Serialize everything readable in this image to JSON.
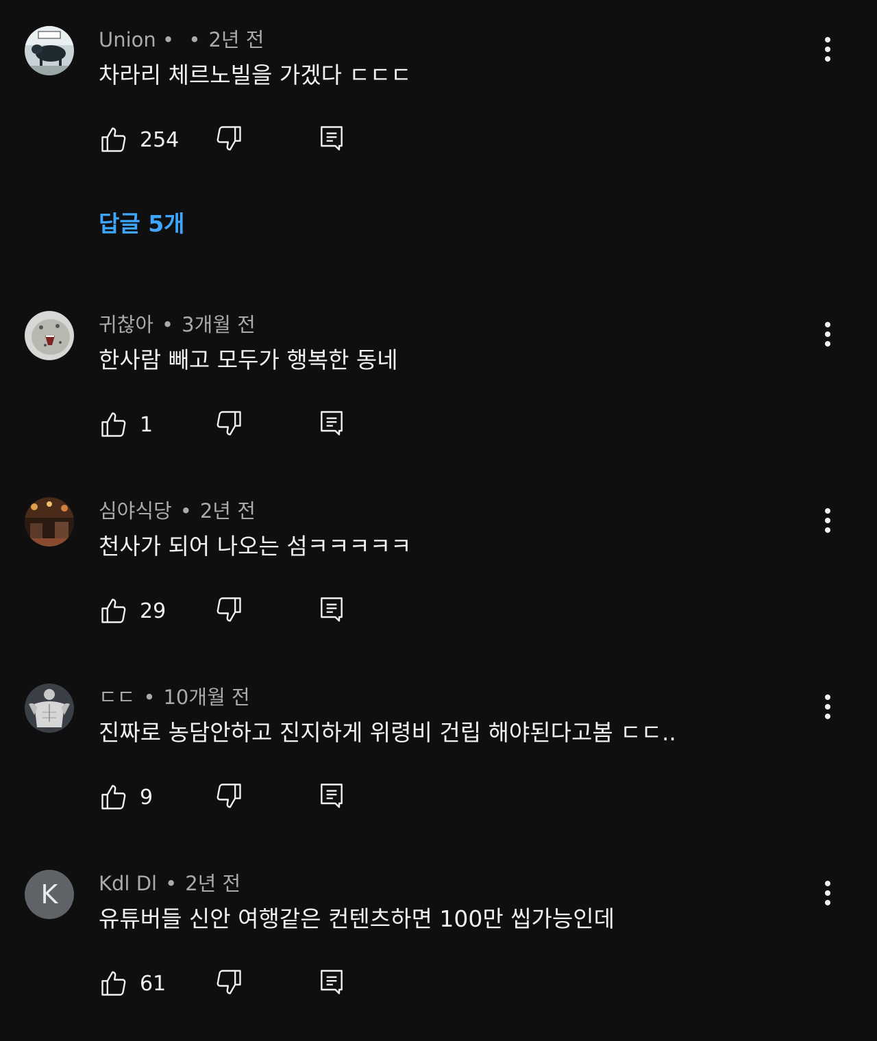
{
  "comments": [
    {
      "author": "Union • ",
      "time": "2년 전",
      "text": "차라리 체르노빌을 가겠다 ㄷㄷㄷ",
      "likes": "254",
      "avatar_icon": "dog-photo-avatar"
    },
    {
      "author": "귀찮아",
      "time": "3개월 전",
      "text": "한사람 빼고 모두가 행복한 동네",
      "likes": "1",
      "avatar_icon": "snow-leopard-photo-avatar"
    },
    {
      "author": "심야식당",
      "time": "2년 전",
      "text": "천사가 되어 나오는 섬ㅋㅋㅋㅋㅋ",
      "likes": "29",
      "avatar_icon": "restaurant-photo-avatar"
    },
    {
      "author": "ㄷㄷ",
      "time": "10개월 전",
      "text": "진짜로 농담안하고 진지하게 위령비 건립 해야된다고봄  ㄷㄷ..",
      "likes": "9",
      "avatar_icon": "bodybuilder-photo-avatar"
    },
    {
      "author": "Kdl Dl",
      "time": "2년 전",
      "text": "유튜버들 신안 여행같은 컨텐츠하면 100만 씹가능인데",
      "likes": "61",
      "avatar_letter": "K"
    }
  ],
  "replies_link": "답글 5개",
  "colors": {
    "background": "#0f0f0f",
    "link": "#3ea6ff",
    "meta": "#aaaaaa",
    "text": "#f1f1f1"
  }
}
